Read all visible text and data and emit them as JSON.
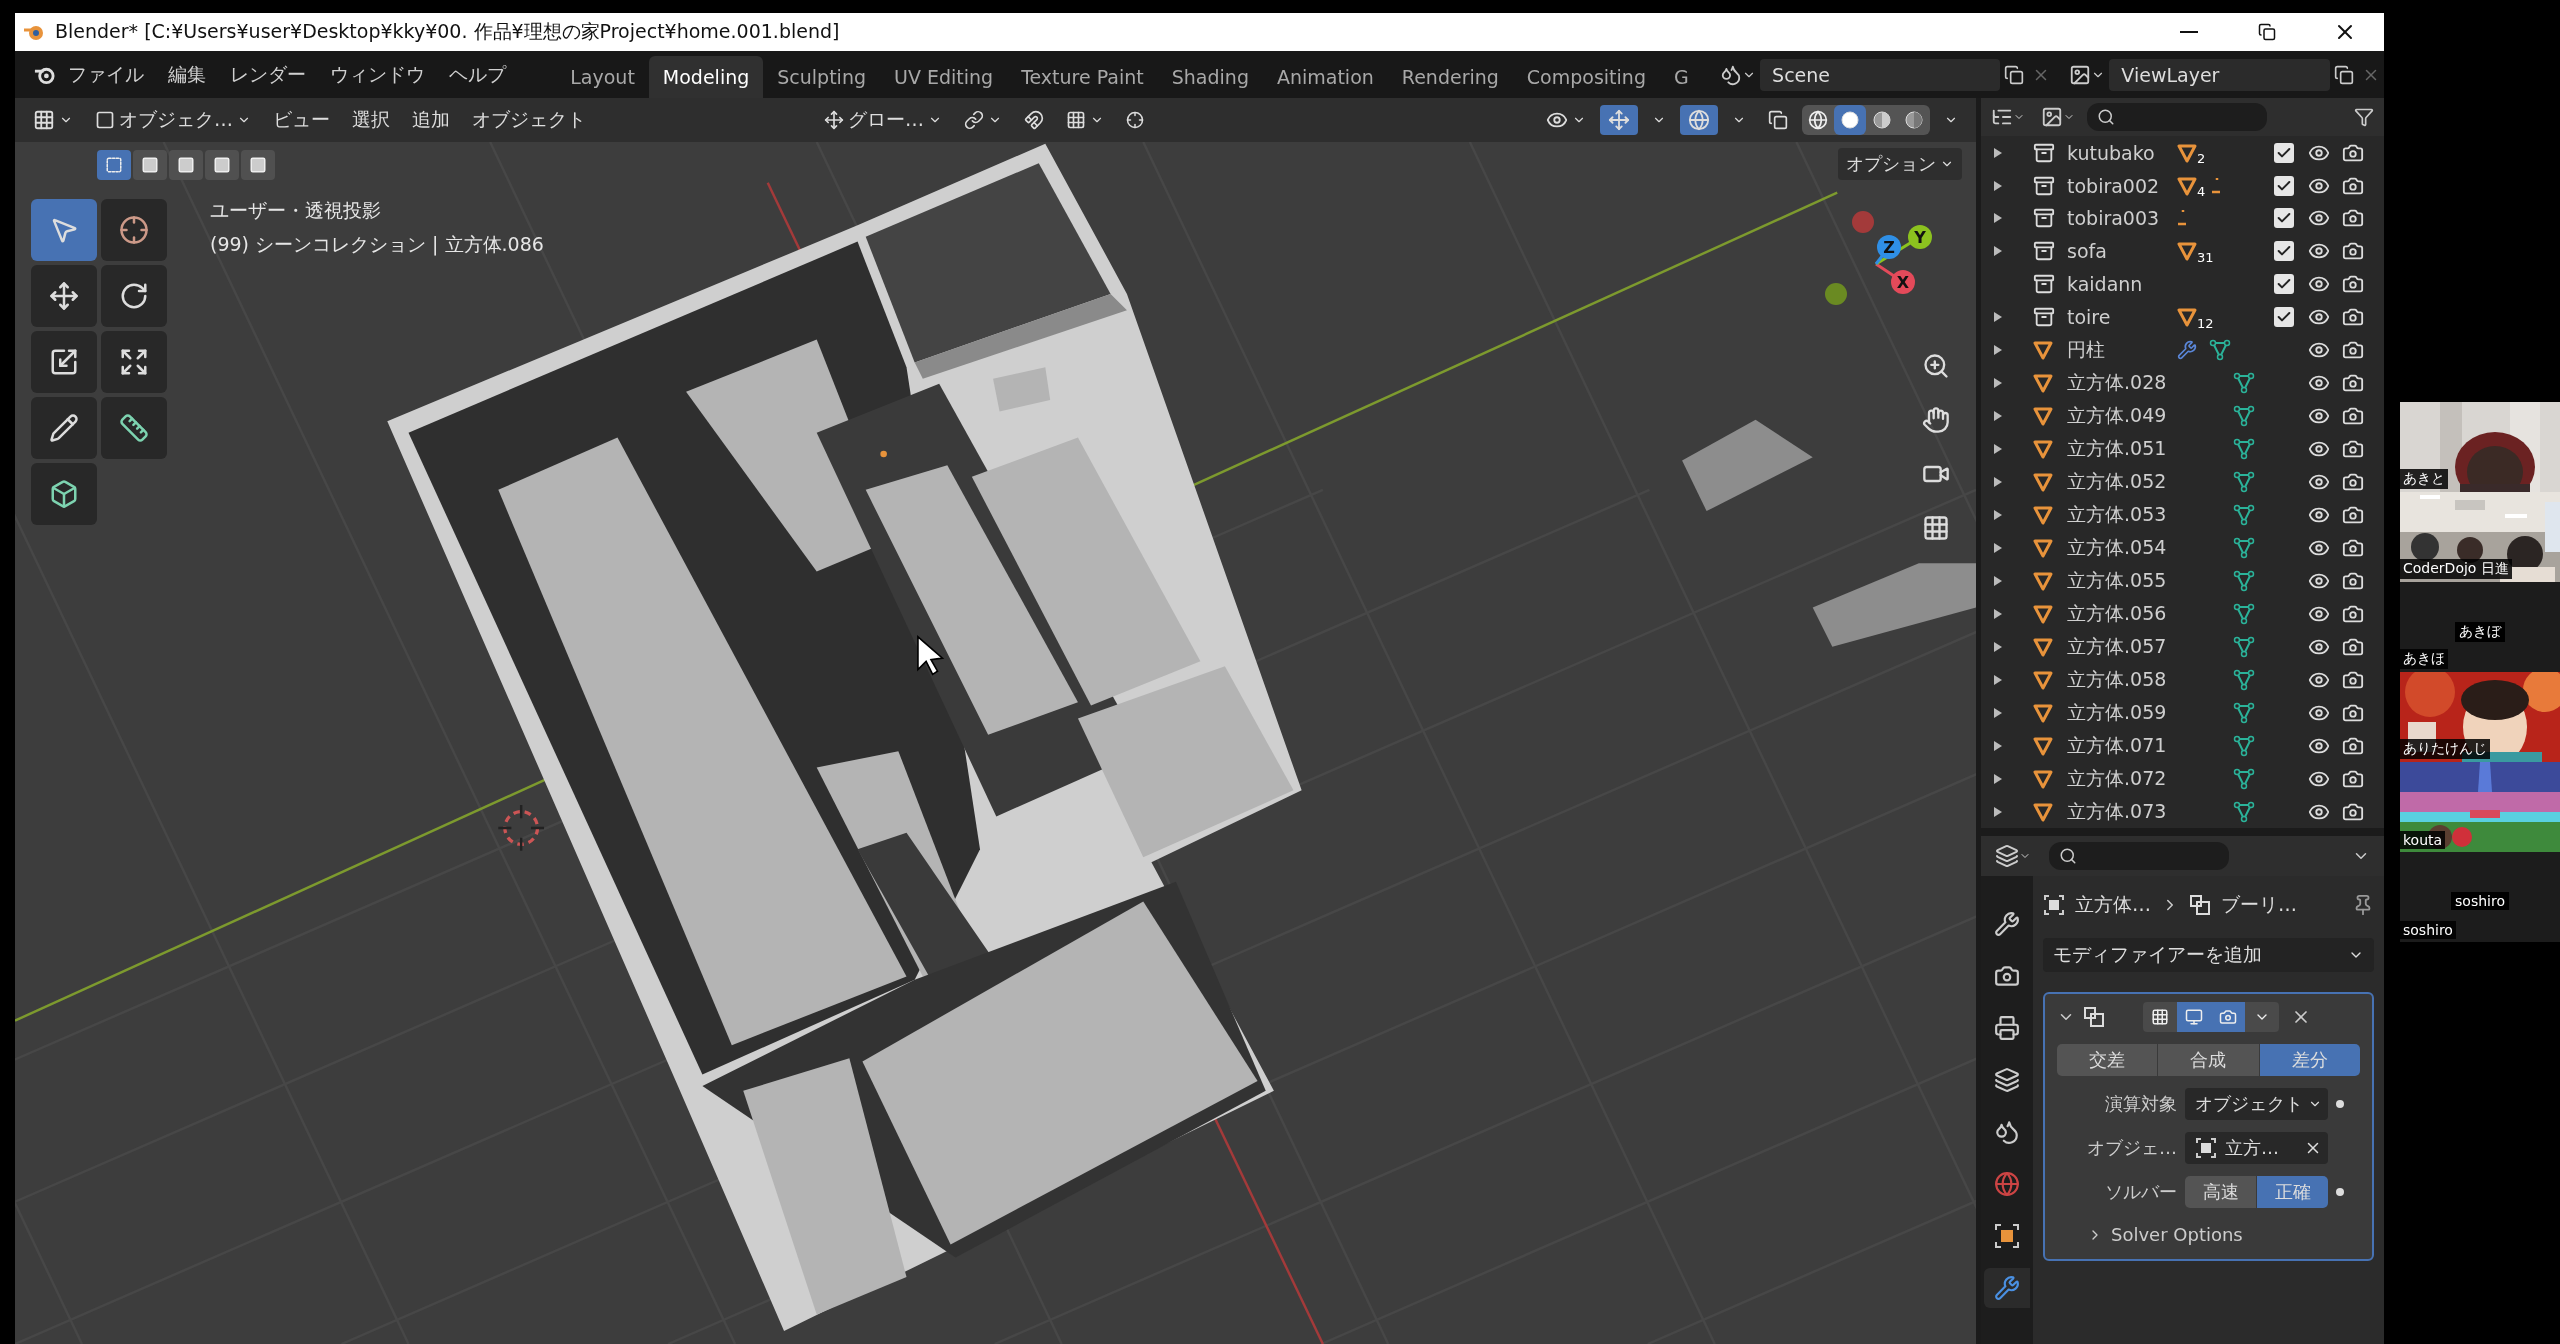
{
  "window": {
    "title": "Blender* [C:¥Users¥user¥Desktop¥kky¥00. 作品¥理想の家Project¥home.001.blend]"
  },
  "menu_bar": {
    "menus": [
      "ファイル",
      "編集",
      "レンダー",
      "ウィンドウ",
      "ヘルプ"
    ],
    "workspaces": [
      {
        "label": "Layout",
        "selected": false
      },
      {
        "label": "Modeling",
        "selected": true
      },
      {
        "label": "Sculpting",
        "selected": false
      },
      {
        "label": "UV Editing",
        "selected": false
      },
      {
        "label": "Texture Paint",
        "selected": false
      },
      {
        "label": "Shading",
        "selected": false
      },
      {
        "label": "Animation",
        "selected": false
      },
      {
        "label": "Rendering",
        "selected": false
      },
      {
        "label": "Compositing",
        "selected": false
      },
      {
        "label": "G",
        "selected": false
      }
    ],
    "scene": "Scene",
    "view_layer": "ViewLayer"
  },
  "viewport": {
    "mode": "オブジェク…",
    "menus": [
      "ビュー",
      "選択",
      "追加",
      "オブジェクト"
    ],
    "orientation": "グロー…",
    "options": "オプション",
    "gizmos_on": true,
    "overlays_on": true,
    "shading": [
      {
        "selected": false
      },
      {
        "selected": true
      },
      {
        "selected": false
      },
      {
        "selected": false
      }
    ],
    "select_modes": [
      {
        "selected": true
      },
      {
        "selected": false
      },
      {
        "selected": false
      },
      {
        "selected": false
      },
      {
        "selected": false
      }
    ],
    "tools": [
      {
        "kind": "select",
        "selected": true
      },
      {
        "kind": "cursor",
        "selected": false
      },
      {
        "kind": "move",
        "selected": false
      },
      {
        "kind": "rotate",
        "selected": false
      },
      {
        "kind": "scale",
        "selected": false
      },
      {
        "kind": "transform",
        "selected": false
      },
      {
        "kind": "annotate",
        "selected": false
      },
      {
        "kind": "measure",
        "selected": false
      },
      {
        "kind": "add_cube",
        "selected": false
      }
    ],
    "overlay_lines": [
      "ユーザー・透視投影",
      "(99) シーンコレクション | 立方体.086"
    ],
    "gizmo_axes": [
      "X",
      "Y",
      "Z"
    ]
  },
  "outliner": {
    "rows": [
      {
        "kind": "collection",
        "name": "kutubako",
        "expandable": true,
        "count": "2",
        "checked": true
      },
      {
        "kind": "collection",
        "name": "tobira002",
        "expandable": true,
        "count": "4",
        "extra_icon": true,
        "checked": true
      },
      {
        "kind": "collection",
        "name": "tobira003",
        "expandable": true,
        "extra_icon": true,
        "checked": true
      },
      {
        "kind": "collection",
        "name": "sofa",
        "expandable": true,
        "count": "31",
        "checked": true
      },
      {
        "kind": "collection",
        "name": "kaidann",
        "expandable": false,
        "checked": true
      },
      {
        "kind": "collection",
        "name": "toire",
        "expandable": true,
        "count": "12",
        "checked": true
      },
      {
        "kind": "object",
        "name": "円柱",
        "expandable": true,
        "modifier": true
      },
      {
        "kind": "object",
        "name": "立方体.028",
        "expandable": true
      },
      {
        "kind": "object",
        "name": "立方体.049",
        "expandable": true
      },
      {
        "kind": "object",
        "name": "立方体.051",
        "expandable": true
      },
      {
        "kind": "object",
        "name": "立方体.052",
        "expandable": true
      },
      {
        "kind": "object",
        "name": "立方体.053",
        "expandable": true
      },
      {
        "kind": "object",
        "name": "立方体.054",
        "expandable": true
      },
      {
        "kind": "object",
        "name": "立方体.055",
        "expandable": true
      },
      {
        "kind": "object",
        "name": "立方体.056",
        "expandable": true
      },
      {
        "kind": "object",
        "name": "立方体.057",
        "expandable": true
      },
      {
        "kind": "object",
        "name": "立方体.058",
        "expandable": true
      },
      {
        "kind": "object",
        "name": "立方体.059",
        "expandable": true
      },
      {
        "kind": "object",
        "name": "立方体.071",
        "expandable": true
      },
      {
        "kind": "object",
        "name": "立方体.072",
        "expandable": true
      },
      {
        "kind": "object",
        "name": "立方体.073",
        "expandable": true
      }
    ]
  },
  "properties": {
    "tabs": [
      {
        "kind": "tool",
        "selected": false
      },
      {
        "kind": "render",
        "selected": false
      },
      {
        "kind": "output",
        "selected": false
      },
      {
        "kind": "view_layer",
        "selected": false
      },
      {
        "kind": "scene",
        "selected": false
      },
      {
        "kind": "world",
        "selected": false
      },
      {
        "kind": "object",
        "selected": false
      },
      {
        "kind": "modifier",
        "selected": true
      }
    ],
    "breadcrumb": [
      "立方体…",
      "ブーリ…"
    ],
    "add_modifier": "モディファイアーを追加",
    "modifier": {
      "expanded": true,
      "edit_mode": false,
      "viewport": true,
      "render": true,
      "operations": [
        {
          "label": "交差",
          "selected": false
        },
        {
          "label": "合成",
          "selected": false
        },
        {
          "label": "差分",
          "selected": true
        }
      ],
      "operand_label": "演算対象",
      "operand": "オブジェクト",
      "object_label": "オブジェ…",
      "object": "立方…",
      "solver_label": "ソルバー",
      "solvers": [
        {
          "label": "高速",
          "selected": false
        },
        {
          "label": "正確",
          "selected": true
        }
      ],
      "solver_options": "Solver Options"
    }
  },
  "participants": [
    {
      "name": "あきと",
      "video": true
    },
    {
      "name": "CoderDojo 日進",
      "video": true
    },
    {
      "name": "あきほ",
      "video": false,
      "center_label": "あきぼ"
    },
    {
      "name": "ありたけんじ",
      "video": true
    },
    {
      "name": "kouta",
      "video": true
    },
    {
      "name": "soshiro",
      "video": false,
      "center_label": "soshiro"
    }
  ]
}
